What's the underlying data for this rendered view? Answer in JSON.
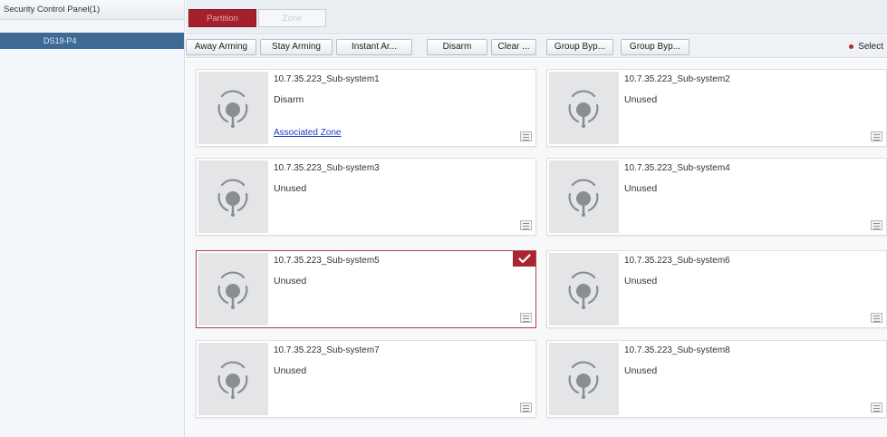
{
  "left_panel": {
    "header": "Security Control Panel(1)",
    "tree_item": "DS19-P4"
  },
  "tabs": [
    {
      "label": "Partition",
      "active": true
    },
    {
      "label": "Zone",
      "active": false
    }
  ],
  "toolbar": {
    "buttons": [
      "Away Arming",
      "Stay Arming",
      "Instant Ar...",
      "Disarm",
      "Clear ...",
      "Group Byp...",
      "Group Byp..."
    ],
    "select_all": "Select"
  },
  "cards": [
    {
      "title": "10.7.35.223_Sub-system1",
      "status": "Disarm",
      "link": "Associated Zone",
      "selected": false
    },
    {
      "title": "10.7.35.223_Sub-system2",
      "status": "Unused",
      "selected": false
    },
    {
      "title": "10.7.35.223_Sub-system3",
      "status": "Unused",
      "selected": false
    },
    {
      "title": "10.7.35.223_Sub-system4",
      "status": "Unused",
      "selected": false
    },
    {
      "title": "10.7.35.223_Sub-system5",
      "status": "Unused",
      "selected": true
    },
    {
      "title": "10.7.35.223_Sub-system6",
      "status": "Unused",
      "selected": false
    },
    {
      "title": "10.7.35.223_Sub-system7",
      "status": "Unused",
      "selected": false
    },
    {
      "title": "10.7.35.223_Sub-system8",
      "status": "Unused",
      "selected": false
    }
  ],
  "icons": {
    "card_icon": "partition-antenna-icon",
    "menu_icon": "list-icon",
    "check_icon": "checkmark-icon"
  },
  "colors": {
    "accent": "#a61f2d",
    "tree_selected": "#3f6a96",
    "link": "#1a3fcc"
  }
}
